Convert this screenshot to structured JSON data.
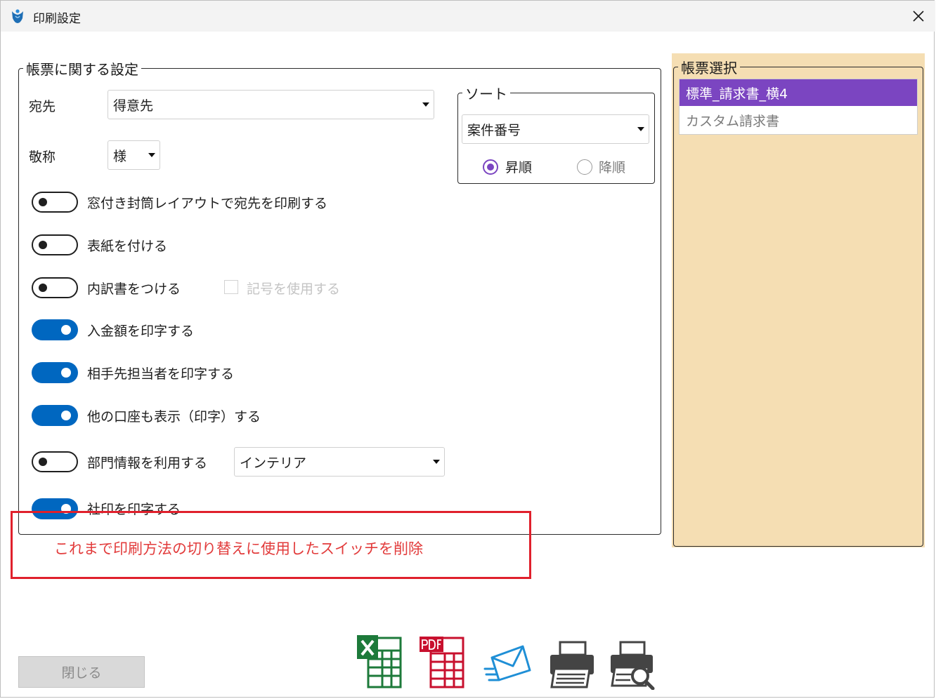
{
  "window": {
    "title": "印刷設定"
  },
  "form_settings": {
    "legend": "帳票に関する設定",
    "recipient": {
      "label": "宛先",
      "value": "得意先"
    },
    "honorific": {
      "label": "敬称",
      "value": "様"
    },
    "toggles": [
      {
        "label": "窓付き封筒レイアウトで宛先を印刷する",
        "on": false
      },
      {
        "label": "表紙を付ける",
        "on": false
      },
      {
        "label": "内訳書をつける",
        "on": false
      },
      {
        "label": "入金額を印字する",
        "on": true
      },
      {
        "label": "相手先担当者を印字する",
        "on": true
      },
      {
        "label": "他の口座も表示（印字）する",
        "on": true
      },
      {
        "label": "部門情報を利用する",
        "on": false
      },
      {
        "label": "社印を印字する",
        "on": true
      }
    ],
    "symbol_checkbox": {
      "label": "記号を使用する",
      "checked": false,
      "disabled": true
    },
    "department": {
      "value": "インテリア"
    }
  },
  "sort": {
    "legend": "ソート",
    "value": "案件番号",
    "ascending_label": "昇順",
    "descending_label": "降順",
    "selected": "ascending"
  },
  "form_select": {
    "legend": "帳票選択",
    "items": [
      {
        "label": "標準_請求書_横4",
        "selected": true
      },
      {
        "label": "カスタム請求書",
        "selected": false
      }
    ]
  },
  "annotation": {
    "text": "これまで印刷方法の切り替えに使用したスイッチを削除",
    "color": "#e0202c"
  },
  "footer": {
    "close_label": "閉じる",
    "tools": [
      "excel-icon",
      "pdf-icon",
      "mail-icon",
      "printer-icon",
      "print-preview-icon"
    ]
  },
  "colors": {
    "accent": "#0067c0",
    "selection": "#7b45c1",
    "panel_bg": "#f5deb3"
  }
}
